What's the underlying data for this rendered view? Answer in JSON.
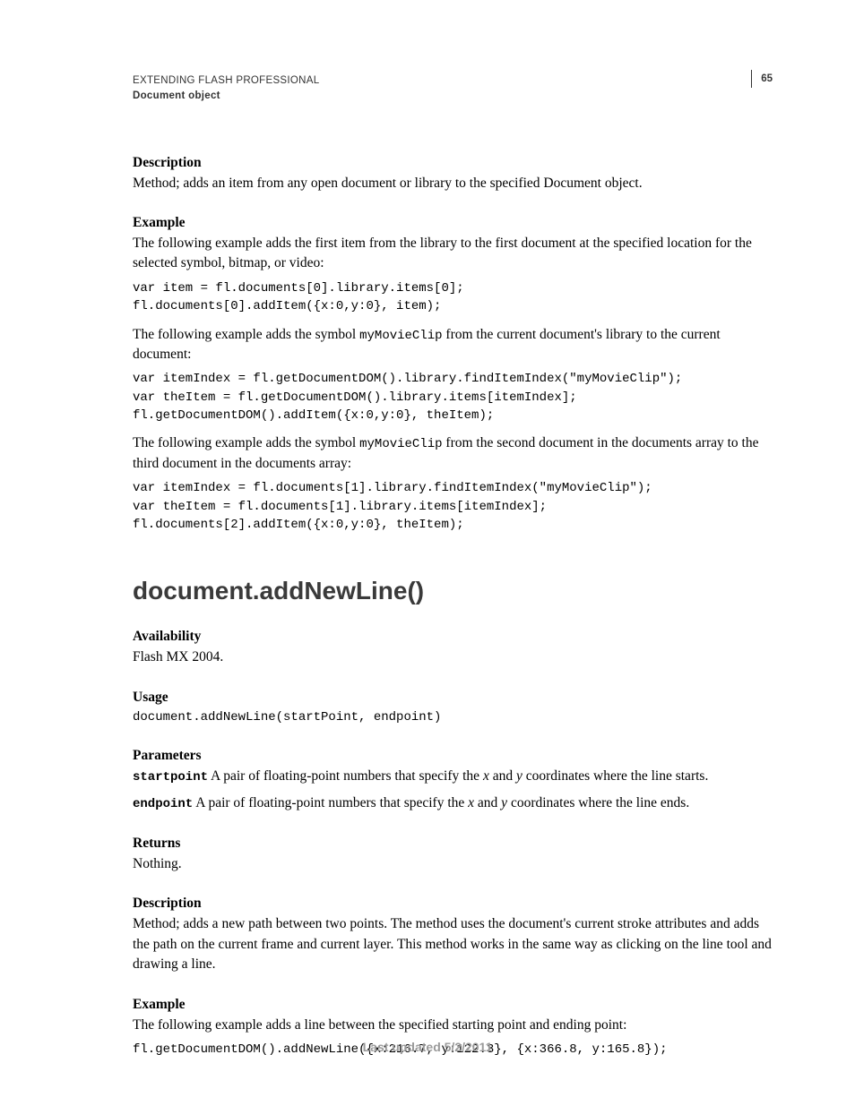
{
  "header": {
    "line1": "EXTENDING FLASH PROFESSIONAL",
    "line2": "Document object",
    "pageNumber": "65"
  },
  "sec1": {
    "desc_h": "Description",
    "desc_t": "Method; adds an item from any open document or library to the specified Document object.",
    "ex_h": "Example",
    "ex_intro1": "The following example adds the first item from the library to the first document at the specified location for the selected symbol, bitmap, or video:",
    "code1": "var item = fl.documents[0].library.items[0];\nfl.documents[0].addItem({x:0,y:0}, item);",
    "ex_intro2a": "The following example adds the symbol ",
    "ex_intro2_code": "myMovieClip",
    "ex_intro2b": " from the current document's library to the current document:",
    "code2": "var itemIndex = fl.getDocumentDOM().library.findItemIndex(\"myMovieClip\");\nvar theItem = fl.getDocumentDOM().library.items[itemIndex];\nfl.getDocumentDOM().addItem({x:0,y:0}, theItem);",
    "ex_intro3a": "The following example adds the symbol ",
    "ex_intro3_code": "myMovieClip",
    "ex_intro3b": " from the second document in the documents array to the third document in the documents array:",
    "code3": "var itemIndex = fl.documents[1].library.findItemIndex(\"myMovieClip\");\nvar theItem = fl.documents[1].library.items[itemIndex];\nfl.documents[2].addItem({x:0,y:0}, theItem);"
  },
  "sec2": {
    "heading": "document.addNewLine()",
    "avail_h": "Availability",
    "avail_t": "Flash MX 2004.",
    "usage_h": "Usage",
    "usage_code": "document.addNewLine(startPoint, endpoint)",
    "params_h": "Parameters",
    "param1_name": "startpoint",
    "param1_desc_a": "  A pair of floating-point numbers that specify the ",
    "param1_x": "x",
    "param1_and": " and ",
    "param1_y": "y",
    "param1_desc_b": " coordinates where the line starts.",
    "param2_name": "endpoint",
    "param2_desc_a": "  A pair of floating-point numbers that specify the ",
    "param2_x": "x",
    "param2_and": " and ",
    "param2_y": "y",
    "param2_desc_b": " coordinates where the line ends.",
    "returns_h": "Returns",
    "returns_t": "Nothing.",
    "desc_h": "Description",
    "desc_t": "Method; adds a new path between two points. The method uses the document's current stroke attributes and adds the path on the current frame and current layer. This method works in the same way as clicking on the line tool and drawing a line.",
    "ex_h": "Example",
    "ex_intro": "The following example adds a line between the specified starting point and ending point:",
    "code": "fl.getDocumentDOM().addNewLine({x:216.7, y:122.3}, {x:366.8, y:165.8});"
  },
  "footer": "Last updated 5/2/2011"
}
